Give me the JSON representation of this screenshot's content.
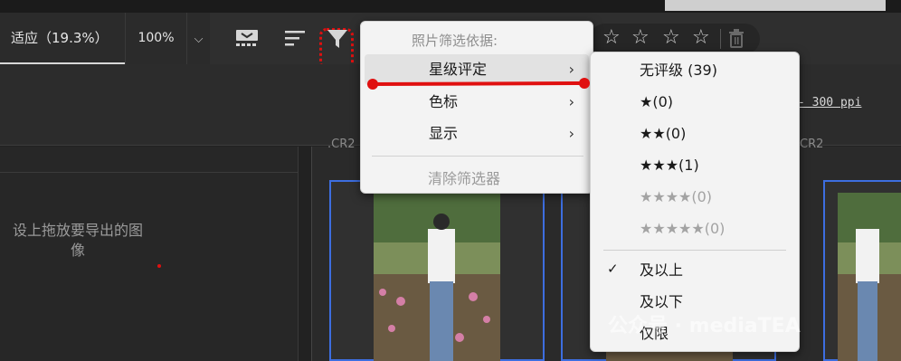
{
  "toolbar": {
    "fit_label": "适应（19.3%）",
    "zoom_label": "100%",
    "zoom_caret": "⌵"
  },
  "filter_menu": {
    "header": "照片筛选依据:",
    "items": [
      {
        "label": "星级评定",
        "chevron": "›"
      },
      {
        "label": "色标",
        "chevron": "›"
      },
      {
        "label": "显示",
        "chevron": "›"
      }
    ],
    "clear_label": "清除筛选器"
  },
  "rating_submenu": {
    "items": [
      {
        "label": "无评级 (39)"
      },
      {
        "label": "★(0)"
      },
      {
        "label": "★★(0)"
      },
      {
        "label": "★★★(1)"
      },
      {
        "label": "★★★★(0)"
      },
      {
        "label": "★★★★★(0)"
      }
    ],
    "modes": [
      {
        "label": "及以上",
        "checked": "✓"
      },
      {
        "label": "及以下"
      },
      {
        "label": "仅限"
      }
    ]
  },
  "rating_bar": {
    "stars": [
      "☆",
      "☆",
      "☆",
      "☆"
    ]
  },
  "panel": {
    "ppi_text": "- 300 ppi",
    "file_ext_left": ".CR2",
    "file_ext_right": "CR2"
  },
  "left_pane": {
    "drop_hint_line1": "设上拖放要导出的图",
    "drop_hint_line2": "像"
  },
  "watermark": {
    "text": "公众号 · mediaTEA"
  },
  "colors": {
    "highlight": "#e01010",
    "selection": "#3d6ee0"
  }
}
